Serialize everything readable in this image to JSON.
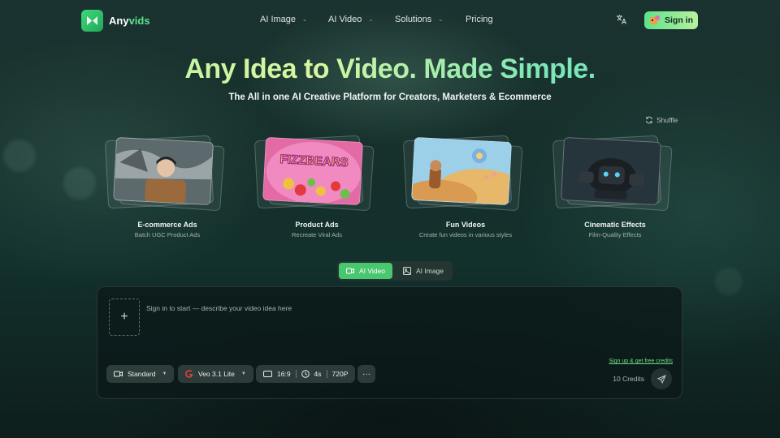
{
  "brand": {
    "name_part1": "Any",
    "name_part2": "vids"
  },
  "nav": {
    "items": [
      {
        "label": "AI Image",
        "has_dropdown": true
      },
      {
        "label": "AI Video",
        "has_dropdown": true
      },
      {
        "label": "Solutions",
        "has_dropdown": true
      },
      {
        "label": "Pricing",
        "has_dropdown": false
      }
    ],
    "language_icon": "translate-icon",
    "signin_label": "Sign in"
  },
  "hero": {
    "title": "Any Idea to Video. Made Simple.",
    "subtitle": "The All in one AI Creative Platform for Creators, Marketers & Ecommerce"
  },
  "shuffle_label": "Shuffle",
  "cards": [
    {
      "title": "E-commerce Ads",
      "subtitle": "Batch UGC Product Ads"
    },
    {
      "title": "Product Ads",
      "subtitle": "Recreate Viral Ads",
      "image_text": "FIZZBEARS"
    },
    {
      "title": "Fun Videos",
      "subtitle": "Create fun videos in various styles"
    },
    {
      "title": "Cinematic Effects",
      "subtitle": "Film-Quality Effects"
    }
  ],
  "mode_tabs": [
    {
      "label": "AI Video",
      "active": true
    },
    {
      "label": "AI Image",
      "active": false
    }
  ],
  "composer": {
    "placeholder": "Sign in to start — describe your video idea here",
    "value": "",
    "add_label": "+",
    "quality": "Standard",
    "model": "Veo 3.1 Lite",
    "aspect_ratio": "16:9",
    "duration": "4s",
    "resolution": "720P",
    "more_label": "···",
    "free_credits_link": "Sign up & get free credits",
    "credits": "10 Credits"
  },
  "colors": {
    "accent": "#49c76f",
    "accent_light": "#b9f0a0",
    "background": "#14302c"
  }
}
